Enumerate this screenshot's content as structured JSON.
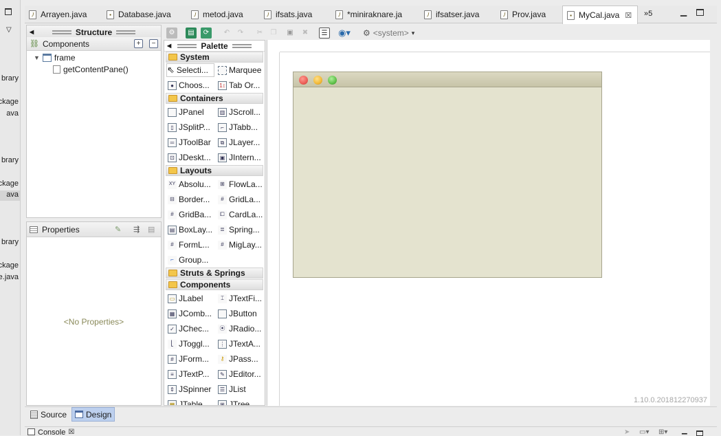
{
  "left_strip": {
    "fragments": [
      "brary",
      "ckage",
      "ava",
      "brary",
      "ckage",
      "ava",
      "brary",
      "ckage",
      "e.java"
    ]
  },
  "tabs": [
    {
      "label": "Arrayen.java",
      "icon": "java-file-icon",
      "active": false
    },
    {
      "label": "Database.java",
      "icon": "java-design-file-icon",
      "active": false
    },
    {
      "label": "metod.java",
      "icon": "java-file-icon",
      "active": false
    },
    {
      "label": "ifsats.java",
      "icon": "java-file-icon",
      "active": false
    },
    {
      "label": "*miniraknare.ja",
      "icon": "java-file-icon",
      "active": false
    },
    {
      "label": "ifsatser.java",
      "icon": "java-file-icon",
      "active": false
    },
    {
      "label": "Prov.java",
      "icon": "java-file-icon",
      "active": false
    },
    {
      "label": "MyCal.java",
      "icon": "java-design-file-icon",
      "active": true
    }
  ],
  "tab_overflow": "»5",
  "structure": {
    "title": "Structure",
    "components_label": "Components",
    "tree": [
      {
        "label": "frame",
        "level": 0
      },
      {
        "label": "getContentPane()",
        "level": 1
      }
    ]
  },
  "properties": {
    "title": "Properties",
    "empty_text": "<No Properties>"
  },
  "toolbar": {
    "system_label": "<system>"
  },
  "palette": {
    "title": "Palette",
    "categories": {
      "system": "System",
      "containers": "Containers",
      "layouts": "Layouts",
      "struts": "Struts & Springs",
      "components": "Components"
    },
    "system_items": [
      "Selecti...",
      "Marquee",
      "Choos...",
      "Tab Or..."
    ],
    "container_items": [
      "JPanel",
      "JScroll...",
      "JSplitP...",
      "JTabb...",
      "JToolBar",
      "JLayer...",
      "JDeskt...",
      "JIntern..."
    ],
    "layout_items": [
      "Absolu...",
      "FlowLa...",
      "Border...",
      "GridLa...",
      "GridBa...",
      "CardLa...",
      "BoxLay...",
      "Spring...",
      "FormL...",
      "MigLay...",
      "Group..."
    ],
    "component_items": [
      "JLabel",
      "JTextFi...",
      "JComb...",
      "JButton",
      "JChec...",
      "JRadio...",
      "JToggl...",
      "JTextA...",
      "JForm...",
      "JPass...",
      "JTextP...",
      "JEditor...",
      "JSpinner",
      "JList",
      "JTable",
      "JTree"
    ]
  },
  "version": "1.10.0.201812270937",
  "bottom_tabs": {
    "source": "Source",
    "design": "Design"
  },
  "console": {
    "label": "Console"
  },
  "colors": {
    "frame_bg": "#e4e3cf",
    "design_tab_active": "#bdd0ee",
    "close_red": "#ec5e57",
    "min_yellow": "#f2b937",
    "max_green": "#5fc04a"
  }
}
